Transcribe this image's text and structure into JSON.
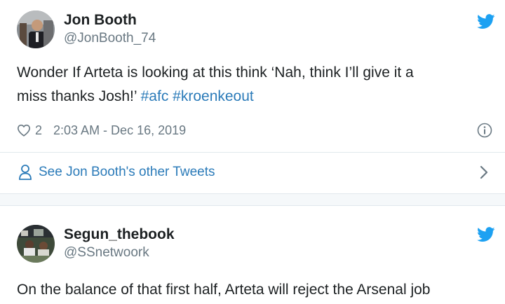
{
  "colors": {
    "link": "#2b7bb9",
    "text": "#1c2022",
    "muted": "#697882",
    "twitter_blue": "#1da1f2",
    "divider": "#e1e8ed"
  },
  "tweet1": {
    "author_name": "Jon Booth",
    "author_handle": "@JonBooth_74",
    "text_line1": "Wonder If Arteta is looking at this think ‘Nah, think I’ll give it a",
    "text_line2_plain": "miss thanks Josh!’ ",
    "hashtag1": "#afc",
    "hashtag2": "#kroenkeout",
    "likes": "2",
    "timestamp": "2:03 AM - Dec 16, 2019",
    "see_more": "See Jon Booth's other Tweets",
    "icons": [
      "twitter-bird-icon",
      "heart-icon",
      "info-icon",
      "person-icon",
      "chevron-right-icon"
    ]
  },
  "tweet2": {
    "author_name": "Segun_thebook",
    "author_handle": "@SSnetwoork",
    "text_line1": "On the balance of that first half, Arteta will reject the Arsenal job",
    "icons": [
      "twitter-bird-icon"
    ]
  }
}
